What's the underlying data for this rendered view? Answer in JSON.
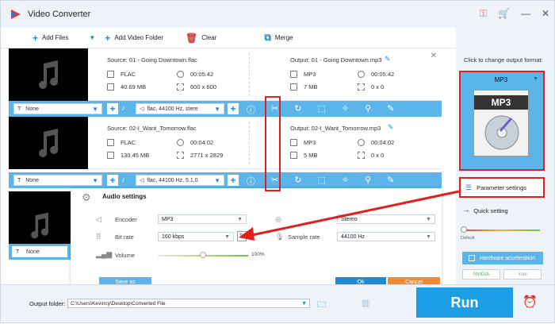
{
  "app": {
    "title": "Video Converter"
  },
  "toolbar": {
    "add_files": "Add Files",
    "add_video_folder": "Add Video Folder",
    "clear": "Clear",
    "merge": "Merge"
  },
  "files": [
    {
      "source_title": "Source: 01 - Going Downtown.flac",
      "src_format": "FLAC",
      "src_duration": "00:05:42",
      "src_size": "40.69 MB",
      "src_resolution": "600 x 600",
      "output_title": "Output: 01 - Going Downtown.mp3",
      "out_format": "MP3",
      "out_duration": "00:05:42",
      "out_size": "7 MB",
      "out_resolution": "0 x 0",
      "subtitle": "None",
      "audio_track": "flac, 44100 Hz, stere"
    },
    {
      "source_title": "Source: 02-I_Want_Tomorrow.flac",
      "src_format": "FLAC",
      "src_duration": "00:04:02",
      "src_size": "130.45 MB",
      "src_resolution": "2771 x 2829",
      "output_title": "Output: 02-I_Want_Tomorrow.mp3",
      "out_format": "MP3",
      "out_duration": "00:04:02",
      "out_size": "5 MB",
      "out_resolution": "0 x 0",
      "subtitle": "None",
      "audio_track": "flac, 44100 Hz, 5.1,0"
    }
  ],
  "third_file": {
    "subtitle": "None"
  },
  "audio_settings": {
    "title": "Audio settings",
    "encoder_label": "Encoder",
    "encoder_value": "MP3",
    "bitrate_label": "Bit rate",
    "bitrate_value": "160 kbps",
    "channel_value": "Stereo",
    "sample_rate_label": "Sample rate",
    "sample_rate_value": "44100 Hz",
    "volume_label": "Volume",
    "volume_value": "100%",
    "volume_level": 0.5,
    "save_as": "Save as",
    "ok": "Ok",
    "cancel": "Cancel"
  },
  "right_panel": {
    "click_label": "Click to change output format:",
    "format_name": "MP3",
    "format_icon_label": "MP3",
    "parameter_settings": "Parameter settings",
    "quick_setting": "Quick setting",
    "default_label": "Default",
    "hardware_accel": "Hardware acceleration",
    "nvidia": "NVIDIA",
    "intel": "Intel"
  },
  "bottom": {
    "output_folder_label": "Output folder:",
    "output_path": "C:\\Users\\Kevincy\\Desktop\\Converted File",
    "run": "Run"
  },
  "colors": {
    "accent": "#5bb4ea",
    "run": "#1c9ee6",
    "highlight": "#e02020",
    "cancel": "#f08a32"
  }
}
